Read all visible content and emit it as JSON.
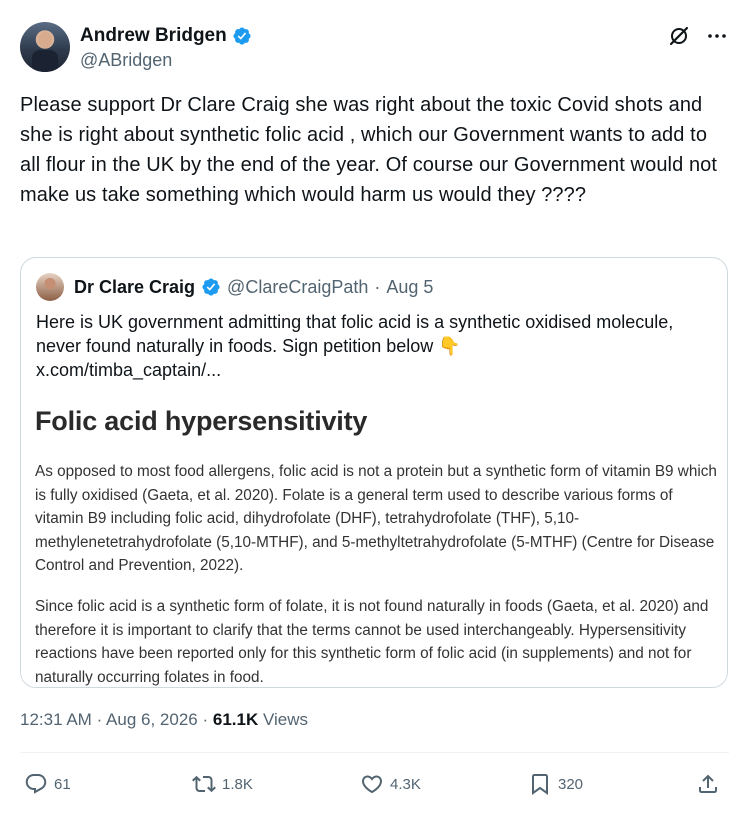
{
  "author": {
    "display_name": "Andrew Bridgen",
    "handle": "@ABridgen"
  },
  "tweet_text": "Please support Dr Clare Craig she was right about the toxic Covid shots and she is right about synthetic folic acid , which our Government wants to add to all flour in the UK by the end of the year.  Of course our Government would not make us take something which would harm us would they ????",
  "quoted_tweet": {
    "display_name": "Dr Clare Craig",
    "handle": "@ClareCraigPath",
    "separator": "·",
    "date": "Aug 5",
    "text_line": "Here is UK government admitting that folic acid is a synthetic oxidised molecule, never found naturally in foods. Sign petition below 👇",
    "link": "x.com/timba_captain/...",
    "image": {
      "title": "Folic acid hypersensitivity",
      "paragraph1": "As opposed to most food allergens, folic acid is not a protein but a synthetic form of vitamin B9 which is fully oxidised (Gaeta, et al. 2020). Folate is a general term used to describe various forms of vitamin B9 including folic acid, dihydrofolate (DHF), tetrahydrofolate (THF), 5,10-methylenetetrahydrofolate (5,10-MTHF), and 5-methyltetrahydrofolate (5-MTHF) (Centre for Disease Control and Prevention, 2022).",
      "paragraph2": "Since folic acid is a synthetic form of folate, it is not found naturally in foods (Gaeta, et al. 2020) and therefore it is important to clarify that the terms cannot be used interchangeably. Hypersensitivity reactions have been reported only for this synthetic form of folic acid (in supplements) and not for naturally occurring folates in food."
    }
  },
  "meta": {
    "time": "12:31 AM",
    "separator": "·",
    "date": "Aug 6, 2026",
    "views_count": "61.1K",
    "views_label": "Views"
  },
  "actions": {
    "replies": "61",
    "reposts": "1.8K",
    "likes": "4.3K",
    "bookmarks": "320"
  },
  "icons": {
    "verified": "verified-badge-icon",
    "grok": "grok-icon",
    "more": "more-icon",
    "reply": "reply-icon",
    "repost": "repost-icon",
    "like": "heart-icon",
    "bookmark": "bookmark-icon",
    "share": "share-icon"
  },
  "colors": {
    "verified_blue": "#1d9bf0",
    "text_primary": "#0f1419",
    "text_secondary": "#536471",
    "border": "#cfd9de"
  }
}
